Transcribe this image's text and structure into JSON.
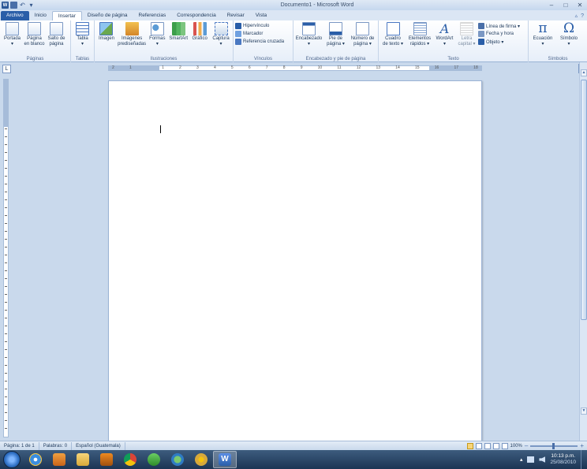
{
  "window": {
    "title": "Documento1 - Microsoft Word"
  },
  "quick_access": {
    "undo": "↶",
    "redo": "▾"
  },
  "window_controls": {
    "minimize": "–",
    "maximize": "□",
    "close": "✕"
  },
  "tabs": [
    {
      "label": "Archivo"
    },
    {
      "label": "Inicio"
    },
    {
      "label": "Insertar"
    },
    {
      "label": "Diseño de página"
    },
    {
      "label": "Referencias"
    },
    {
      "label": "Correspondencia"
    },
    {
      "label": "Revisar"
    },
    {
      "label": "Vista"
    }
  ],
  "tab_icons": {
    "minimize_ribbon": "▵",
    "help": "?"
  },
  "ribbon": {
    "paginas": {
      "label": "Páginas",
      "portada": "Portada\n▾",
      "pagina_blanco": "Página\nen blanco",
      "salto": "Salto de\npágina"
    },
    "tablas": {
      "label": "Tablas",
      "tabla": "Tabla\n▾"
    },
    "ilustraciones": {
      "label": "Ilustraciones",
      "imagen": "Imagen",
      "imagenes_pred": "Imágenes\nprediseñadas",
      "formas": "Formas\n▾",
      "smartart": "SmartArt",
      "grafico": "Gráfico",
      "captura": "Captura\n▾"
    },
    "vinculos": {
      "label": "Vínculos",
      "hipervinculo": "Hipervínculo",
      "marcador": "Marcador",
      "referencia": "Referencia cruzada"
    },
    "encabezado_pie": {
      "label": "Encabezado y pie de página",
      "encabezado": "Encabezado\n▾",
      "pie": "Pie de\npágina ▾",
      "numero": "Número de\npágina ▾"
    },
    "texto": {
      "label": "Texto",
      "cuadro": "Cuadro\nde texto ▾",
      "elementos": "Elementos\nrápidos ▾",
      "wordart": "WordArt\n▾",
      "letra_capital": "Letra\ncapital ▾",
      "linea_firma": "Línea de firma ▾",
      "fecha_hora": "Fecha y hora",
      "objeto": "Objeto ▾"
    },
    "simbolos": {
      "label": "Símbolos",
      "ecuacion": "Ecuación\n▾",
      "ecuacion_glyph": "π",
      "simbolo": "Símbolo\n▾",
      "simbolo_glyph": "Ω"
    }
  },
  "ruler": {
    "toggle": "L",
    "ticks": [
      "2",
      "1",
      "",
      "1",
      "2",
      "3",
      "4",
      "5",
      "6",
      "7",
      "8",
      "9",
      "10",
      "11",
      "12",
      "13",
      "14",
      "15",
      "16",
      "17",
      "18"
    ]
  },
  "scrollbar": {
    "up": "▲",
    "down": "▼"
  },
  "statusbar": {
    "page": "Página: 1 de 1",
    "words": "Palabras: 0",
    "language": "Español (Guatemala)",
    "zoom": "100%",
    "zoom_out": "–",
    "zoom_in": "+",
    "zoom_level": 1.0
  },
  "taskbar": {
    "word_label": "W",
    "tray_up": "▴",
    "time": "10:13 p.m.",
    "date": "25/08/2010"
  },
  "colors": {
    "file_tab": "#2a5ea8",
    "ribbon_bg": "#e6eef9",
    "taskbar": "#1c3554"
  }
}
